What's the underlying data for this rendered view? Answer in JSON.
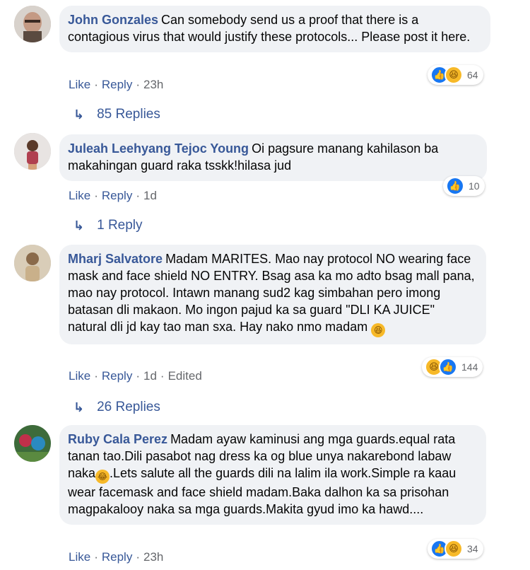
{
  "comments": [
    {
      "author": "John Gonzales",
      "text": "Can somebody send us a proof that there is a contagious virus that would justify these protocols... Please post it here.",
      "like": "Like",
      "reply": "Reply",
      "time": "23h",
      "reaction_count": "64",
      "reactions": [
        "like-icon",
        "haha-icon"
      ],
      "replies": "85 Replies"
    },
    {
      "author": "Juleah Leehyang Tejoc Young",
      "text": "Oi pagsure manang kahilason ba makahingan guard raka tsskk!hilasa jud",
      "like": "Like",
      "reply": "Reply",
      "time": "1d",
      "reaction_count": "10",
      "reactions": [
        "like-icon"
      ],
      "replies": "1 Reply"
    },
    {
      "author": "Mharj Salvatore",
      "text": "Madam MARITES. Mao nay protocol NO wearing face mask and face shield NO ENTRY. Bsag asa ka mo adto bsag mall pana, mao nay protocol. Intawn manang sud2 kag simbahan pero imong batasan dli makaon. Mo ingon pajud ka sa guard \"DLI KA JUICE\" natural dli jd kay tao man sxa. Hay nako nmo madam",
      "like": "Like",
      "reply": "Reply",
      "time": "1d",
      "edited": "Edited",
      "reaction_count": "144",
      "reactions": [
        "haha-icon",
        "like-icon"
      ],
      "replies": "26 Replies"
    },
    {
      "author": "Ruby Cala Perez",
      "text_before": "Madam ayaw kaminusi ang mga guards.equal rata tanan tao.Dili pasabot nag dress ka og blue unya nakarebond labaw naka",
      "text_after": ".Lets salute all the guards dili na lalim ila work.Simple ra kaau wear facemask and face shield madam.Baka dalhon ka sa prisohan magpakalooy naka sa mga guards.Makita gyud imo ka hawd....",
      "like": "Like",
      "reply": "Reply",
      "time": "23h",
      "reaction_count": "34",
      "reactions": [
        "like-icon",
        "haha-icon"
      ]
    }
  ],
  "colors": {
    "link": "#385898",
    "bubble": "#f0f2f5",
    "muted": "#65676b",
    "like": "#1877f2",
    "haha": "#f7b928"
  }
}
